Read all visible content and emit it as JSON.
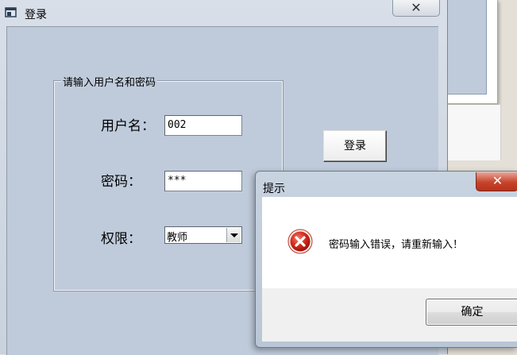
{
  "login_window": {
    "title": "登录",
    "close_glyph": "✕",
    "group_title": "请输入用户名和密码",
    "username_label": "用户名：",
    "username_value": "002",
    "password_label": "密码：",
    "password_value": "***",
    "role_label": "权限：",
    "role_selected": "教师",
    "login_button": "登录"
  },
  "message_box": {
    "title": "提示",
    "close_glyph": "✕",
    "icon": "error-icon",
    "message": "密码输入错误，请重新输入！",
    "ok_button": "确定"
  },
  "colors": {
    "client_bg": "#bfcbdb",
    "error_red": "#c7432a"
  }
}
